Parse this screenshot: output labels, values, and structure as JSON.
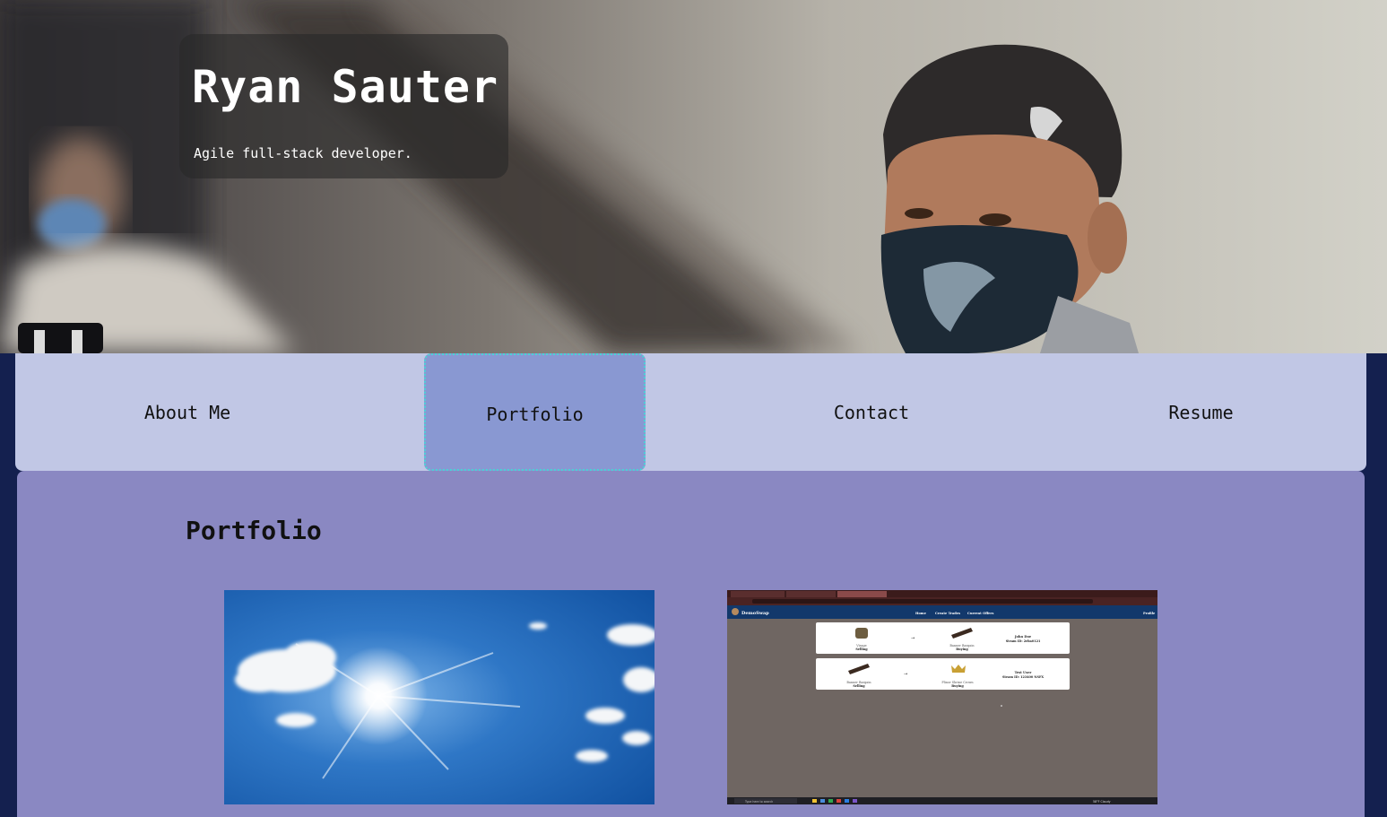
{
  "header": {
    "name": "Ryan Sauter",
    "tagline": "Agile full-stack developer."
  },
  "nav": {
    "items": [
      {
        "label": "About Me",
        "active": false
      },
      {
        "label": "Portfolio",
        "active": true
      },
      {
        "label": "Contact",
        "active": false
      },
      {
        "label": "Resume",
        "active": false
      }
    ]
  },
  "main": {
    "section_title": "Portfolio",
    "projects": [
      {
        "image": "sunny-sky-image"
      },
      {
        "image": "demoswap-app-screenshot",
        "screenshot": {
          "brand": "DemoSwap",
          "nav_links": [
            "Home",
            "Create Trades",
            "Current Offers"
          ],
          "profile_link": "Profile",
          "trades": [
            {
              "offer_item": "Visage",
              "offer_status": "Selling",
              "want_item": "Banner Bargain",
              "want_status": "Buying",
              "user": "John Doe",
              "user_detail": "Steam ID: 2eba0121"
            },
            {
              "offer_item": "Banner Bargain",
              "offer_status": "Selling",
              "want_item": "Plinor Shrine Crown",
              "want_status": "Buying",
              "user": "Test User",
              "user_detail": "Steam ID: 123400 NSFX"
            }
          ],
          "taskbar_search": "Type here to search",
          "weather": "58°F Cloudy"
        }
      }
    ]
  },
  "colors": {
    "page_background": "#14204f",
    "nav_background": "#c1c7e5",
    "nav_active": "#8998d2",
    "nav_active_outline": "#48d4d6",
    "content_background": "#8a88c2"
  }
}
